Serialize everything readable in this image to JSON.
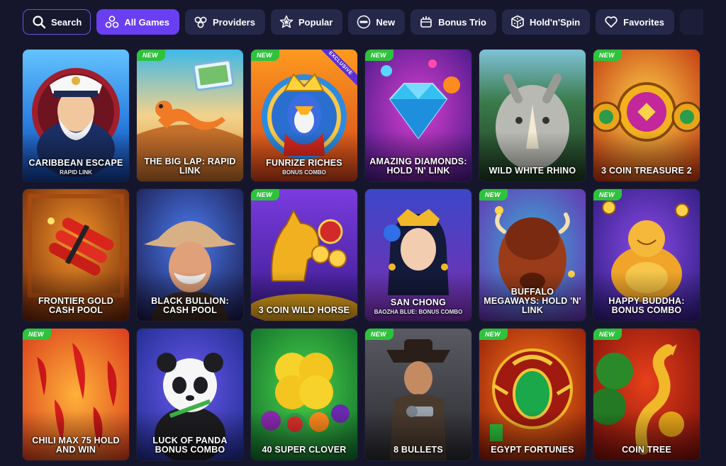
{
  "nav": {
    "search_label": "Search",
    "tabs": [
      {
        "label": "All Games",
        "icon": "all-games-icon"
      },
      {
        "label": "Providers",
        "icon": "providers-icon"
      },
      {
        "label": "Popular",
        "icon": "star-icon"
      },
      {
        "label": "New",
        "icon": "new-icon"
      },
      {
        "label": "Bonus Trio",
        "icon": "bonus-trio-icon"
      },
      {
        "label": "Hold'n'Spin",
        "icon": "dice-icon"
      },
      {
        "label": "Favorites",
        "icon": "heart-icon"
      }
    ],
    "active_tab": "All Games",
    "accent_color": "#6a3ff2"
  },
  "games": [
    {
      "title": "CARIBBEAN ESCAPE",
      "subtitle": "RAPID LINK",
      "badge": "",
      "ribbon": ""
    },
    {
      "title": "THE BIG LAP: RAPID LINK",
      "subtitle": "",
      "badge": "NEW",
      "ribbon": ""
    },
    {
      "title": "FUNRIZE RICHES",
      "subtitle": "BONUS COMBO",
      "badge": "NEW",
      "ribbon": "EXCLUSIVE"
    },
    {
      "title": "AMAZING DIAMONDS: HOLD 'N' LINK",
      "subtitle": "",
      "badge": "NEW",
      "ribbon": ""
    },
    {
      "title": "WILD WHITE RHINO",
      "subtitle": "",
      "badge": "",
      "ribbon": ""
    },
    {
      "title": "3 COIN TREASURE 2",
      "subtitle": "",
      "badge": "NEW",
      "ribbon": ""
    },
    {
      "title": "FRONTIER GOLD CASH POOL",
      "subtitle": "",
      "badge": "",
      "ribbon": ""
    },
    {
      "title": "BLACK BULLION: CASH POOL",
      "subtitle": "",
      "badge": "",
      "ribbon": ""
    },
    {
      "title": "3 COIN WILD HORSE",
      "subtitle": "",
      "badge": "NEW",
      "ribbon": ""
    },
    {
      "title": "SAN CHONG",
      "subtitle": "BAOZHA BLUE: BONUS COMBO",
      "badge": "",
      "ribbon": ""
    },
    {
      "title": "BUFFALO MEGAWAYS: HOLD 'N' LINK",
      "subtitle": "",
      "badge": "NEW",
      "ribbon": ""
    },
    {
      "title": "HAPPY BUDDHA: BONUS COMBO",
      "subtitle": "",
      "badge": "NEW",
      "ribbon": ""
    },
    {
      "title": "CHILI MAX 75 HOLD AND WIN",
      "subtitle": "",
      "badge": "NEW",
      "ribbon": ""
    },
    {
      "title": "LUCK OF PANDA BONUS COMBO",
      "subtitle": "",
      "badge": "",
      "ribbon": ""
    },
    {
      "title": "40 SUPER CLOVER",
      "subtitle": "",
      "badge": "",
      "ribbon": ""
    },
    {
      "title": "8 BULLETS",
      "subtitle": "",
      "badge": "NEW",
      "ribbon": ""
    },
    {
      "title": "EGYPT FORTUNES",
      "subtitle": "",
      "badge": "NEW",
      "ribbon": ""
    },
    {
      "title": "COIN TREE",
      "subtitle": "",
      "badge": "NEW",
      "ribbon": ""
    }
  ],
  "colors": {
    "background": "#15162c",
    "pill": "#26284a",
    "new_badge": "#2fc23d"
  }
}
